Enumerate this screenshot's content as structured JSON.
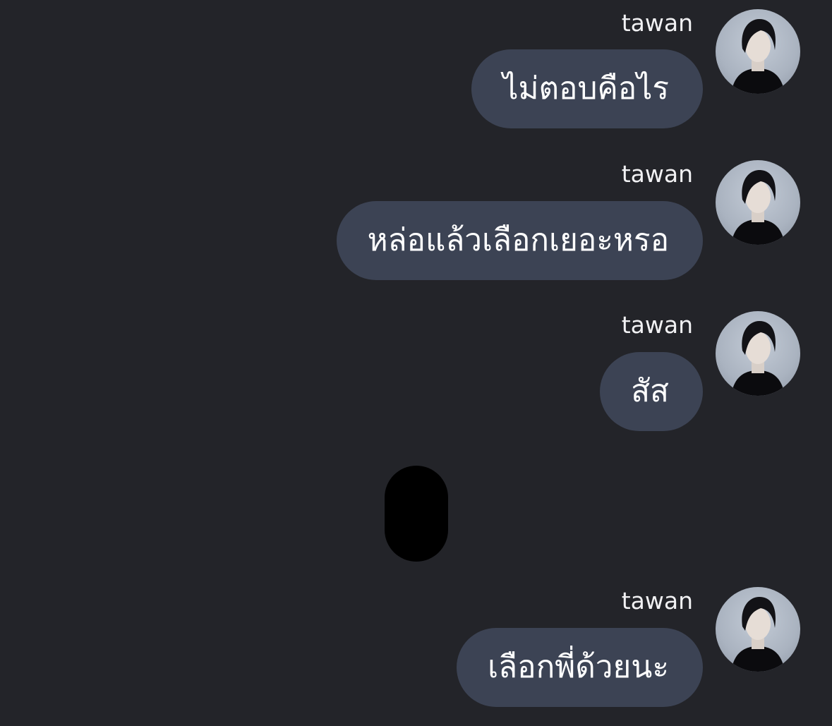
{
  "messages": [
    {
      "sender": "tawan",
      "text": "ไม่ตอบคือไร",
      "avatar_icon": "profile-photo"
    },
    {
      "sender": "tawan",
      "text": "หล่อแล้วเลือกเยอะหรอ",
      "avatar_icon": "profile-photo"
    },
    {
      "sender": "tawan",
      "text": "สัส",
      "avatar_icon": "profile-photo"
    },
    {
      "sender": "tawan",
      "text": "เลือกพี่ด้วยนะ",
      "avatar_icon": "profile-photo"
    }
  ],
  "colors": {
    "background": "#232429",
    "bubble": "#3c4354",
    "text": "#ffffff",
    "redaction": "#000000"
  }
}
